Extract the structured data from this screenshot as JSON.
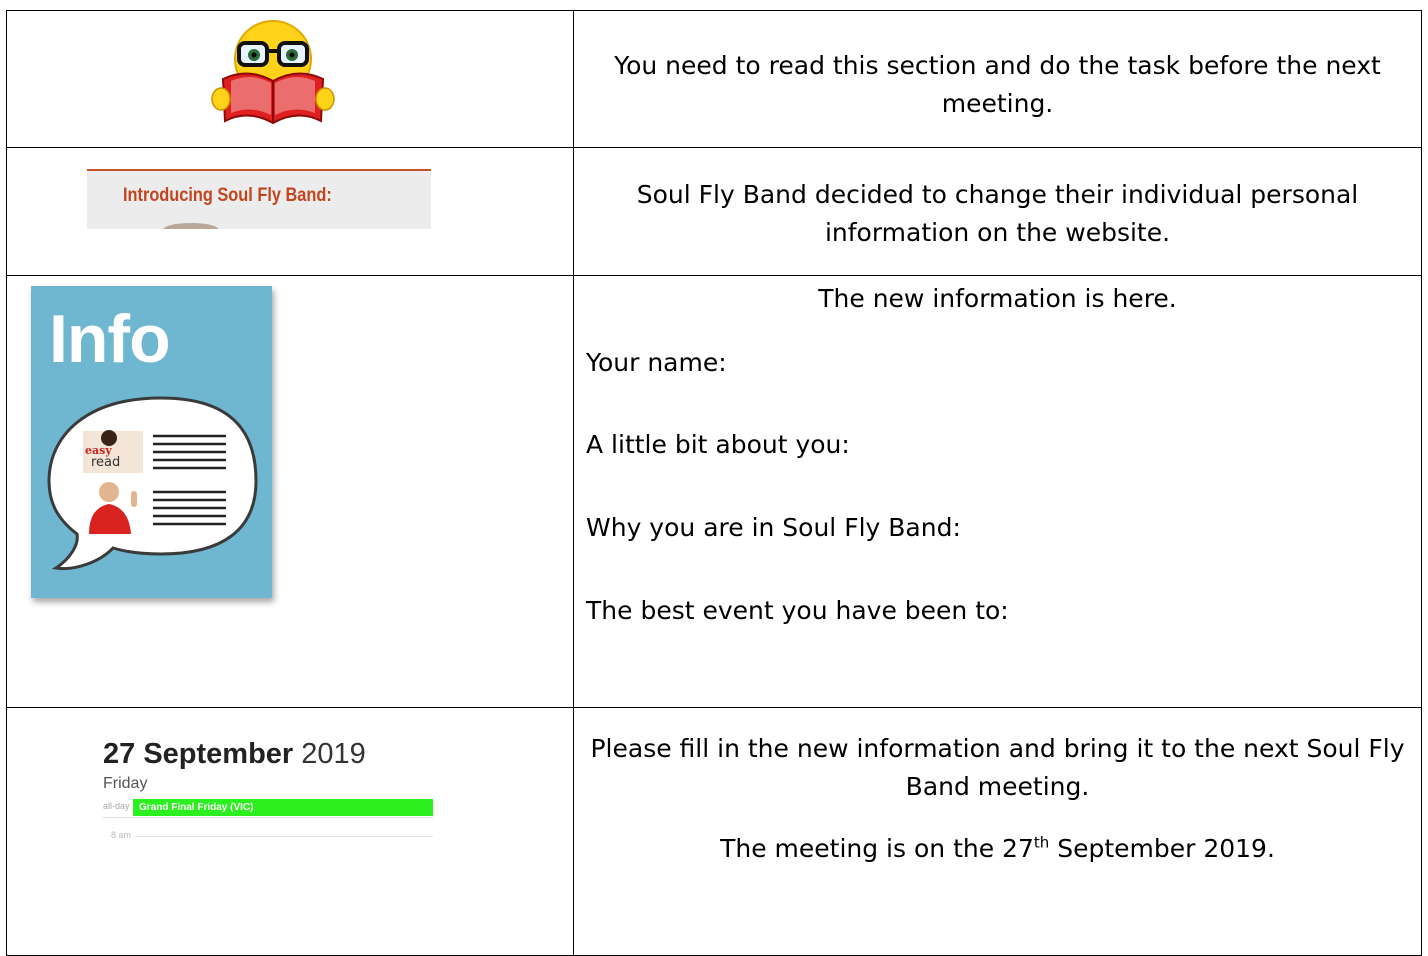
{
  "rows": [
    {
      "text": "You need to read this section and do the task before the next meeting."
    },
    {
      "banner": "Introducing Soul Fly Band:",
      "text": "Soul Fly Band decided to change their individual personal information on the website."
    },
    {
      "poster_title": "Info",
      "poster_badge": "easy read",
      "heading": "The new information is here.",
      "labels": [
        "Your name:",
        "A little bit about you:",
        "Why you are in Soul Fly Band:",
        "The best event you have been to:"
      ]
    },
    {
      "calendar": {
        "date_bold": "27 September",
        "year": "2019",
        "day": "Friday",
        "allday_label": "all-day",
        "event": "Grand Final Friday (VIC)",
        "hour": "8 am"
      },
      "text1": "Please fill in the new information and bring it to the next Soul Fly Band meeting.",
      "text2_pre": "The meeting is on the 27",
      "text2_sup": "th",
      "text2_post": " September 2019."
    }
  ],
  "colors": {
    "banner_text": "#c2451e",
    "event_green": "#2bef1e",
    "poster_blue": "#6fb7d1"
  },
  "icons": [
    "reading-book-emoji-icon",
    "info-speech-bubble-icon"
  ]
}
